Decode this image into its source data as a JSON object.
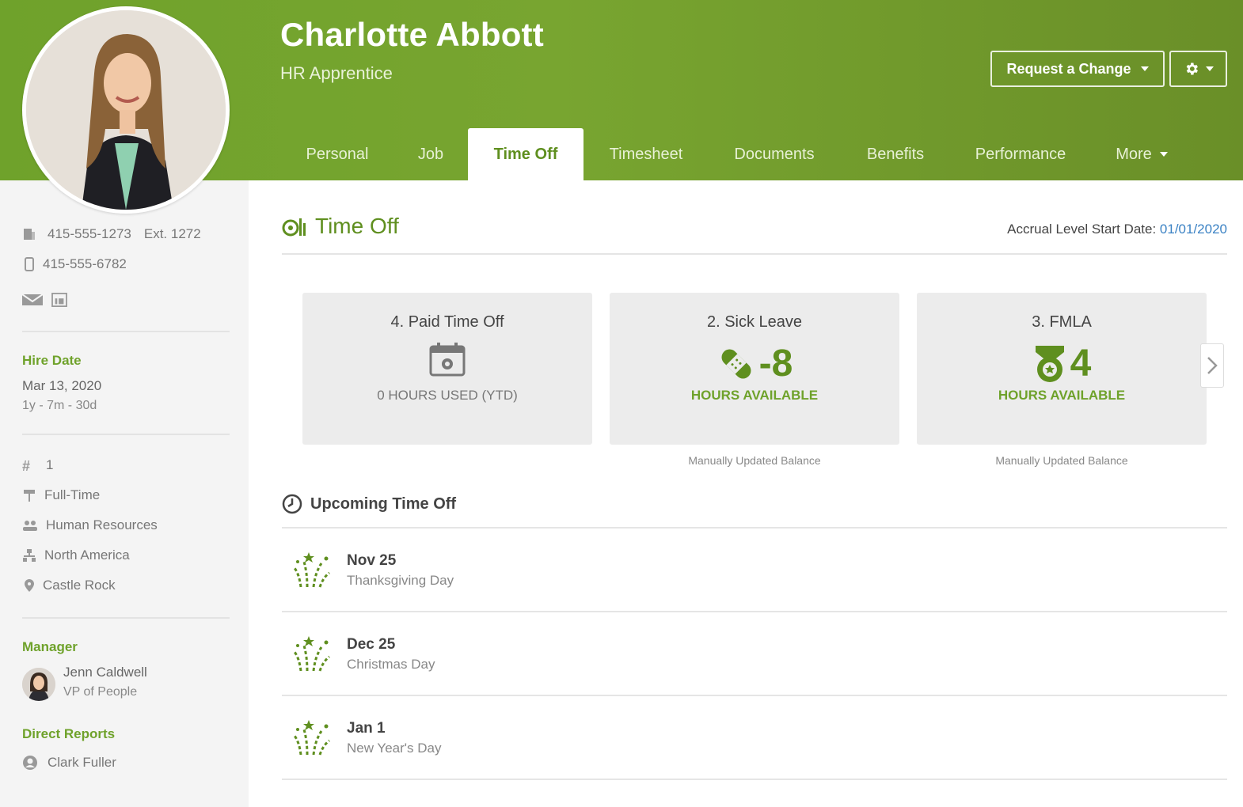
{
  "employee": {
    "name": "Charlotte Abbott",
    "title": "HR Apprentice"
  },
  "header": {
    "request_change_label": "Request a Change"
  },
  "tabs": [
    {
      "label": "Personal",
      "active": false
    },
    {
      "label": "Job",
      "active": false
    },
    {
      "label": "Time Off",
      "active": true
    },
    {
      "label": "Timesheet",
      "active": false
    },
    {
      "label": "Documents",
      "active": false
    },
    {
      "label": "Benefits",
      "active": false
    },
    {
      "label": "Performance",
      "active": false
    },
    {
      "label": "More",
      "active": false
    }
  ],
  "sidebar": {
    "work_phone": "415-555-1273",
    "extension": "Ext. 1272",
    "mobile_phone": "415-555-6782",
    "hire_date_label": "Hire Date",
    "hire_date": "Mar 13, 2020",
    "tenure": "1y - 7m - 30d",
    "employee_number": "1",
    "employment_status": "Full-Time",
    "department": "Human Resources",
    "division": "North America",
    "location": "Castle Rock",
    "manager_label": "Manager",
    "manager_name": "Jenn Caldwell",
    "manager_title": "VP of People",
    "direct_reports_label": "Direct Reports",
    "direct_report_name": "Clark Fuller"
  },
  "time_off": {
    "section_title": "Time Off",
    "accrual_label": "Accrual Level Start Date:",
    "accrual_date": "01/01/2020",
    "cards": [
      {
        "title": "4. Paid Time Off",
        "value": "",
        "sub": "0 HOURS USED (YTD)",
        "note": ""
      },
      {
        "title": "2. Sick Leave",
        "value": "-8",
        "sub": "HOURS AVAILABLE",
        "note": "Manually Updated Balance"
      },
      {
        "title": "3. FMLA",
        "value": "4",
        "sub": "HOURS AVAILABLE",
        "note": "Manually Updated Balance"
      }
    ],
    "upcoming_title": "Upcoming Time Off",
    "upcoming": [
      {
        "date": "Nov 25",
        "name": "Thanksgiving Day"
      },
      {
        "date": "Dec 25",
        "name": "Christmas Day"
      },
      {
        "date": "Jan 1",
        "name": "New Year's Day"
      }
    ]
  },
  "colors": {
    "brand_green": "#6fa22b",
    "dark_green": "#5f8f1f",
    "link_blue": "#3b82c4"
  }
}
